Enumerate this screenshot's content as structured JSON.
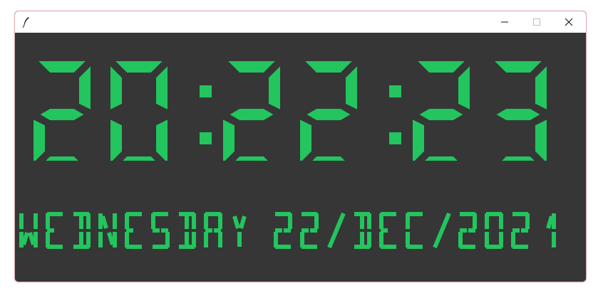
{
  "window": {
    "title": "",
    "controls": {
      "minimize_icon": "minimize-icon",
      "maximize_icon": "maximize-icon",
      "close_icon": "close-icon"
    },
    "app_icon": "feather-icon"
  },
  "clock": {
    "time": "20:22:23",
    "date": "WEDNESDAY 22/DEC/2021"
  },
  "colors": {
    "background": "#363636",
    "segment_on": "#22c55e",
    "titlebar": "#ffffff"
  }
}
